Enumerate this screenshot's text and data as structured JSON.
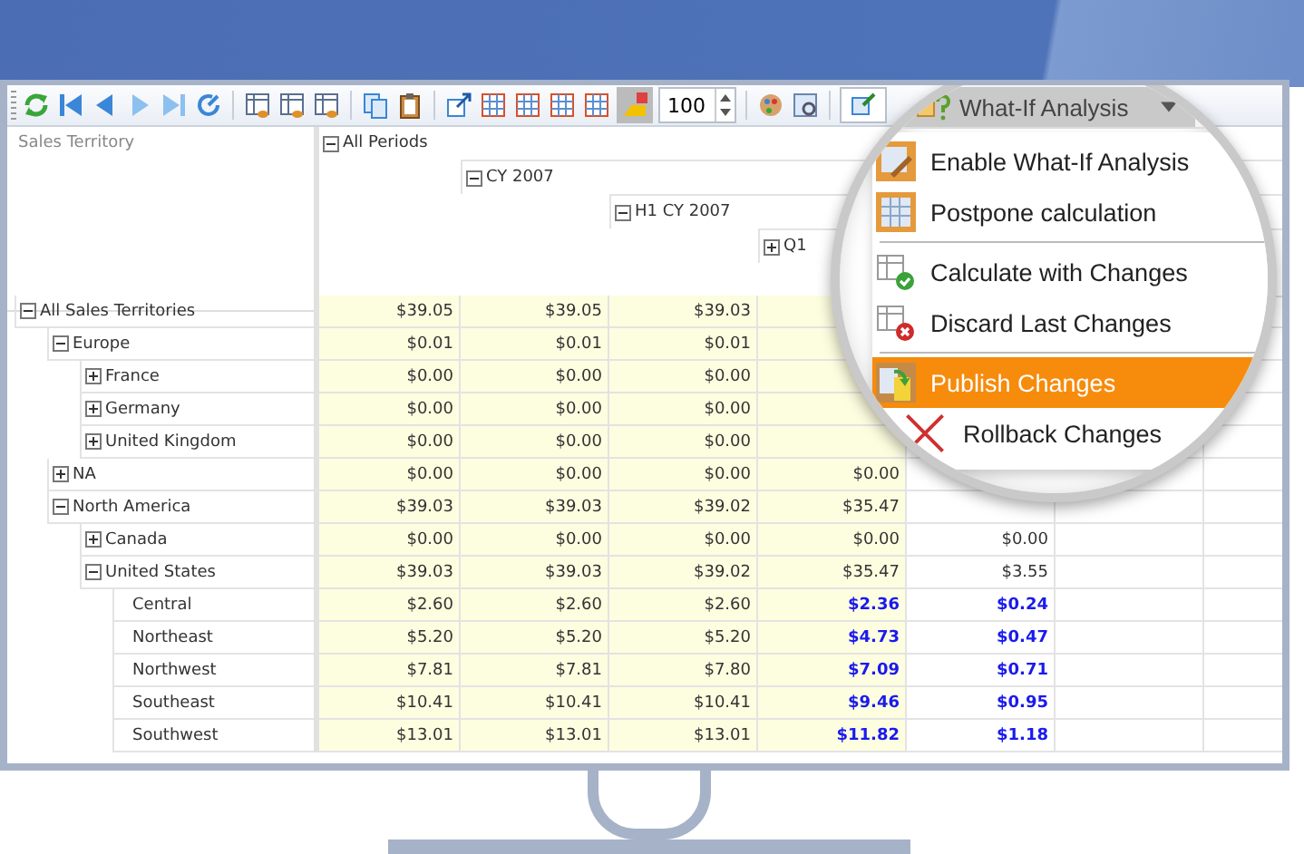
{
  "toolbar": {
    "zoom_value": "100"
  },
  "pivot": {
    "row_header": "Sales Territory",
    "column_headers": [
      {
        "label": "All Periods",
        "expanded": true,
        "children": [
          {
            "label": "CY 2007",
            "expanded": true,
            "children": [
              {
                "label": "H1 CY 2007",
                "expanded": true,
                "children": [
                  {
                    "label": "Q1",
                    "expanded": false
                  }
                ]
              }
            ]
          }
        ]
      }
    ],
    "rows": [
      {
        "label": "All Sales Territories",
        "expanded": true,
        "values": [
          {
            "text": "$39.05",
            "changed": false
          },
          {
            "text": "$39.05",
            "changed": false
          },
          {
            "text": "$39.03",
            "changed": false
          }
        ],
        "children": [
          {
            "label": "Europe",
            "expanded": true,
            "values": [
              {
                "text": "$0.01",
                "changed": false
              },
              {
                "text": "$0.01",
                "changed": false
              },
              {
                "text": "$0.01",
                "changed": false
              }
            ],
            "children": [
              {
                "label": "France",
                "expanded": false,
                "values": [
                  {
                    "text": "$0.00",
                    "changed": false
                  },
                  {
                    "text": "$0.00",
                    "changed": false
                  },
                  {
                    "text": "$0.00",
                    "changed": false
                  }
                ]
              },
              {
                "label": "Germany",
                "expanded": false,
                "values": [
                  {
                    "text": "$0.00",
                    "changed": false
                  },
                  {
                    "text": "$0.00",
                    "changed": false
                  },
                  {
                    "text": "$0.00",
                    "changed": false
                  }
                ]
              },
              {
                "label": "United Kingdom",
                "expanded": false,
                "values": [
                  {
                    "text": "$0.00",
                    "changed": false
                  },
                  {
                    "text": "$0.00",
                    "changed": false
                  },
                  {
                    "text": "$0.00",
                    "changed": false
                  }
                ]
              }
            ]
          },
          {
            "label": "NA",
            "expanded": false,
            "values": [
              {
                "text": "$0.00",
                "changed": false
              },
              {
                "text": "$0.00",
                "changed": false
              },
              {
                "text": "$0.00",
                "changed": false
              },
              {
                "text": "$0.00",
                "changed": false
              }
            ]
          },
          {
            "label": "North America",
            "expanded": true,
            "values": [
              {
                "text": "$39.03",
                "changed": false
              },
              {
                "text": "$39.03",
                "changed": false
              },
              {
                "text": "$39.02",
                "changed": false
              },
              {
                "text": "$35.47",
                "changed": false
              }
            ],
            "children": [
              {
                "label": "Canada",
                "expanded": false,
                "values": [
                  {
                    "text": "$0.00",
                    "changed": false
                  },
                  {
                    "text": "$0.00",
                    "changed": false
                  },
                  {
                    "text": "$0.00",
                    "changed": false
                  },
                  {
                    "text": "$0.00",
                    "changed": false
                  },
                  {
                    "text": "$0.00",
                    "changed": false
                  }
                ]
              },
              {
                "label": "United States",
                "expanded": true,
                "values": [
                  {
                    "text": "$39.03",
                    "changed": false
                  },
                  {
                    "text": "$39.03",
                    "changed": false
                  },
                  {
                    "text": "$39.02",
                    "changed": false
                  },
                  {
                    "text": "$35.47",
                    "changed": false
                  },
                  {
                    "text": "$3.55",
                    "changed": false
                  }
                ],
                "children": [
                  {
                    "label": "Central",
                    "values": [
                      {
                        "text": "$2.60",
                        "changed": false
                      },
                      {
                        "text": "$2.60",
                        "changed": false
                      },
                      {
                        "text": "$2.60",
                        "changed": false
                      },
                      {
                        "text": "$2.36",
                        "changed": true
                      },
                      {
                        "text": "$0.24",
                        "changed": true
                      }
                    ]
                  },
                  {
                    "label": "Northeast",
                    "values": [
                      {
                        "text": "$5.20",
                        "changed": false
                      },
                      {
                        "text": "$5.20",
                        "changed": false
                      },
                      {
                        "text": "$5.20",
                        "changed": false
                      },
                      {
                        "text": "$4.73",
                        "changed": true
                      },
                      {
                        "text": "$0.47",
                        "changed": true
                      }
                    ]
                  },
                  {
                    "label": "Northwest",
                    "values": [
                      {
                        "text": "$7.81",
                        "changed": false
                      },
                      {
                        "text": "$7.81",
                        "changed": false
                      },
                      {
                        "text": "$7.80",
                        "changed": false
                      },
                      {
                        "text": "$7.09",
                        "changed": true
                      },
                      {
                        "text": "$0.71",
                        "changed": true
                      }
                    ]
                  },
                  {
                    "label": "Southeast",
                    "values": [
                      {
                        "text": "$10.41",
                        "changed": false
                      },
                      {
                        "text": "$10.41",
                        "changed": false
                      },
                      {
                        "text": "$10.41",
                        "changed": false
                      },
                      {
                        "text": "$9.46",
                        "changed": true
                      },
                      {
                        "text": "$0.95",
                        "changed": true
                      }
                    ]
                  },
                  {
                    "label": "Southwest",
                    "values": [
                      {
                        "text": "$13.01",
                        "changed": false
                      },
                      {
                        "text": "$13.01",
                        "changed": false
                      },
                      {
                        "text": "$13.01",
                        "changed": false
                      },
                      {
                        "text": "$11.82",
                        "changed": true
                      },
                      {
                        "text": "$1.18",
                        "changed": true
                      }
                    ]
                  }
                ]
              }
            ]
          }
        ]
      }
    ]
  },
  "magnifier": {
    "dropdown": {
      "label": "What-If Analysis"
    },
    "menu_groups": [
      [
        {
          "label": "Enable What-If Analysis",
          "kind": "enable",
          "selected": false
        },
        {
          "label": "Postpone calculation",
          "kind": "postpone",
          "selected": false
        }
      ],
      [
        {
          "label": "Calculate with Changes",
          "kind": "calculate",
          "selected": false
        },
        {
          "label": "Discard Last Changes",
          "kind": "discard",
          "selected": false
        }
      ],
      [
        {
          "label": "Publish Changes",
          "kind": "publish",
          "selected": true
        },
        {
          "label": "Rollback Changes",
          "kind": "rollback",
          "selected": false
        }
      ]
    ]
  }
}
